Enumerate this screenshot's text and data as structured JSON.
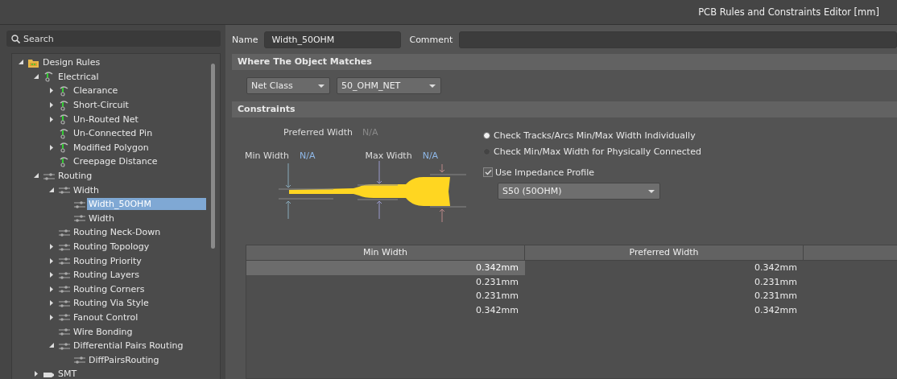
{
  "window": {
    "title": "PCB Rules and Constraints Editor [mm]"
  },
  "search": {
    "placeholder": "Search"
  },
  "tree": [
    {
      "label": "Design Rules",
      "kind": "folder",
      "expanded": true,
      "selected": false,
      "children": [
        {
          "label": "Electrical",
          "kind": "electrical",
          "expanded": true,
          "selected": false,
          "children": [
            {
              "label": "Clearance",
              "kind": "electrical",
              "expanded": false,
              "selected": false
            },
            {
              "label": "Short-Circuit",
              "kind": "electrical",
              "expanded": false,
              "selected": false
            },
            {
              "label": "Un-Routed Net",
              "kind": "electrical",
              "expanded": false,
              "selected": false
            },
            {
              "label": "Un-Connected Pin",
              "kind": "electrical",
              "selected": false
            },
            {
              "label": "Modified Polygon",
              "kind": "electrical",
              "expanded": false,
              "selected": false
            },
            {
              "label": "Creepage Distance",
              "kind": "electrical",
              "selected": false
            }
          ]
        },
        {
          "label": "Routing",
          "kind": "routing",
          "expanded": true,
          "selected": false,
          "children": [
            {
              "label": "Width",
              "kind": "routing",
              "expanded": true,
              "selected": false,
              "children": [
                {
                  "label": "Width_50OHM",
                  "kind": "routing",
                  "selected": true
                },
                {
                  "label": "Width",
                  "kind": "routing",
                  "selected": false
                }
              ]
            },
            {
              "label": "Routing Neck-Down",
              "kind": "routing",
              "selected": false
            },
            {
              "label": "Routing Topology",
              "kind": "routing",
              "expanded": false,
              "selected": false
            },
            {
              "label": "Routing Priority",
              "kind": "routing",
              "expanded": false,
              "selected": false
            },
            {
              "label": "Routing Layers",
              "kind": "routing",
              "expanded": false,
              "selected": false
            },
            {
              "label": "Routing Corners",
              "kind": "routing",
              "expanded": false,
              "selected": false
            },
            {
              "label": "Routing Via Style",
              "kind": "routing",
              "expanded": false,
              "selected": false
            },
            {
              "label": "Fanout Control",
              "kind": "routing",
              "expanded": false,
              "selected": false
            },
            {
              "label": "Wire Bonding",
              "kind": "routing",
              "selected": false
            },
            {
              "label": "Differential Pairs Routing",
              "kind": "routing",
              "expanded": true,
              "selected": false,
              "children": [
                {
                  "label": "DiffPairsRouting",
                  "kind": "routing",
                  "selected": false
                }
              ]
            }
          ]
        },
        {
          "label": "SMT",
          "kind": "smt",
          "expanded": false,
          "selected": false
        }
      ]
    }
  ],
  "name_field": {
    "label": "Name",
    "value": "Width_50OHM"
  },
  "comment_field": {
    "label": "Comment"
  },
  "where_section": {
    "title": "Where The Object Matches",
    "dropdowns": [
      "Net Class",
      "50_OHM_NET"
    ]
  },
  "constraints": {
    "title": "Constraints",
    "preferred_width": {
      "label": "Preferred Width",
      "value": "N/A",
      "disabled": true
    },
    "min_width": {
      "label": "Min Width",
      "value": "N/A",
      "disabled": false
    },
    "max_width": {
      "label": "Max Width",
      "value": "N/A",
      "disabled": false
    },
    "check_modes": [
      {
        "label": "Check Tracks/Arcs Min/Max Width Individually",
        "selected": true
      },
      {
        "label": "Check Min/Max Width for Physically Connected",
        "selected": false
      }
    ],
    "impedance": {
      "label": "Use Impedance Profile",
      "checked": true,
      "profile": "S50 (50OHM)"
    }
  },
  "table": {
    "columns": [
      "Min Width",
      "Preferred Width"
    ],
    "rows": [
      {
        "cells": [
          "0.342mm",
          "0.342mm"
        ],
        "selected": true
      },
      {
        "cells": [
          "0.231mm",
          "0.231mm"
        ],
        "selected": false
      },
      {
        "cells": [
          "0.231mm",
          "0.231mm"
        ],
        "selected": false
      },
      {
        "cells": [
          "0.342mm",
          "0.342mm"
        ],
        "selected": false
      }
    ]
  }
}
